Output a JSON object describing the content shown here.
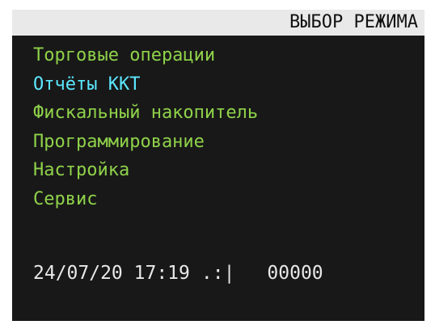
{
  "screen": {
    "title": "ВЫБОР РЕЖИМА",
    "colors": {
      "background": "#181818",
      "title_bar": "#e9e9e9",
      "menu_item": "#8fd24a",
      "menu_item_selected": "#5ce8ff",
      "status_text": "#e8e8e8"
    }
  },
  "menu": {
    "selected_index": 1,
    "items": [
      {
        "label": "Торговые операции"
      },
      {
        "label": "Отчёты ККТ"
      },
      {
        "label": "Фискальный накопитель"
      },
      {
        "label": "Программирование"
      },
      {
        "label": "Настройка"
      },
      {
        "label": "Сервис"
      }
    ]
  },
  "status": {
    "datetime": "24/07/20 17:19",
    "signal": ".:|",
    "counter": "00000"
  }
}
